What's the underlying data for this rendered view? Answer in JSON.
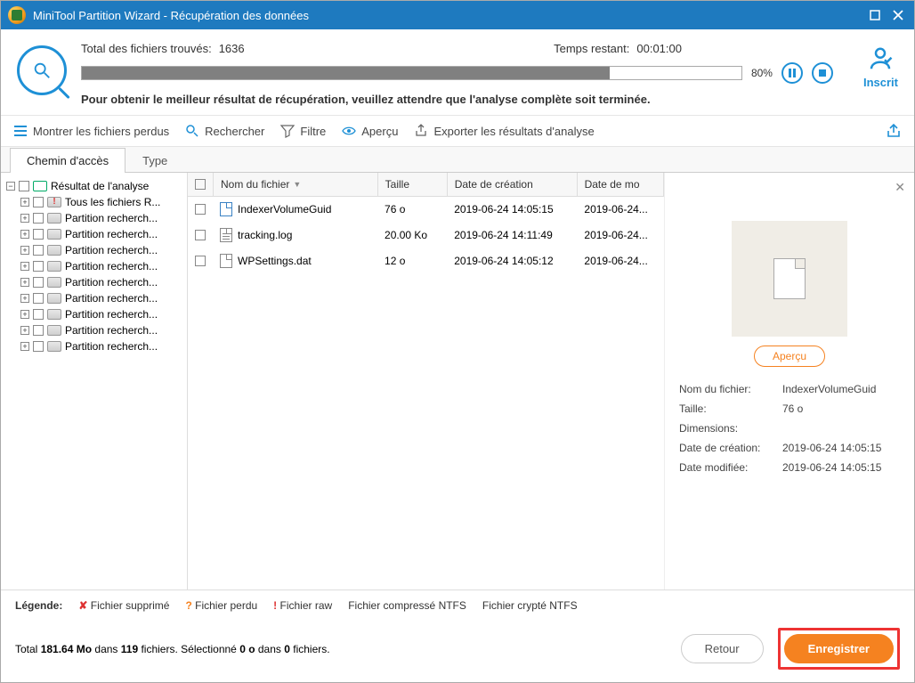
{
  "title": "MiniTool Partition Wizard - Récupération des données",
  "header": {
    "found_label": "Total des fichiers trouvés:",
    "found_value": "1636",
    "remain_label": "Temps restant:",
    "remain_value": "00:01:00",
    "progress_percent": "80%",
    "tip": "Pour obtenir le meilleur résultat de récupération, veuillez attendre que l'analyse complète soit terminée.",
    "inscrit": "Inscrit"
  },
  "toolbar": {
    "show_lost": "Montrer les fichiers perdus",
    "search": "Rechercher",
    "filter": "Filtre",
    "preview": "Aperçu",
    "export": "Exporter les résultats d'analyse"
  },
  "tabs": {
    "path": "Chemin d'accès",
    "type": "Type"
  },
  "tree": {
    "root": "Résultat de l'analyse",
    "items": [
      "Tous les fichiers R...",
      "Partition recherch...",
      "Partition recherch...",
      "Partition recherch...",
      "Partition recherch...",
      "Partition recherch...",
      "Partition recherch...",
      "Partition recherch...",
      "Partition recherch...",
      "Partition recherch..."
    ]
  },
  "columns": {
    "name": "Nom du fichier",
    "size": "Taille",
    "created": "Date de création",
    "modified": "Date de mo"
  },
  "files": [
    {
      "name": "IndexerVolumeGuid",
      "size": "76 o",
      "created": "2019-06-24 14:05:15",
      "modified": "2019-06-24...",
      "icon": "blue"
    },
    {
      "name": "tracking.log",
      "size": "20.00 Ko",
      "created": "2019-06-24 14:11:49",
      "modified": "2019-06-24...",
      "icon": "lines"
    },
    {
      "name": "WPSettings.dat",
      "size": "12 o",
      "created": "2019-06-24 14:05:12",
      "modified": "2019-06-24...",
      "icon": "plain"
    }
  ],
  "detail": {
    "preview_btn": "Aperçu",
    "k_name": "Nom du fichier:",
    "v_name": "IndexerVolumeGuid",
    "k_size": "Taille:",
    "v_size": "76 o",
    "k_dim": "Dimensions:",
    "v_dim": "",
    "k_created": "Date de création:",
    "v_created": "2019-06-24 14:05:15",
    "k_modified": "Date modifiée:",
    "v_modified": "2019-06-24 14:05:15"
  },
  "legend": {
    "label": "Légende:",
    "deleted": "Fichier supprimé",
    "lost": "Fichier perdu",
    "raw": "Fichier raw",
    "ntfs_c": "Fichier compressé NTFS",
    "ntfs_e": "Fichier crypté NTFS"
  },
  "status": {
    "prefix": "Total ",
    "total_size": "181.64 Mo",
    "mid1": " dans ",
    "total_files": "119",
    "mid2": " fichiers.  Sélectionné ",
    "sel_size": "0 o",
    "mid3": " dans ",
    "sel_files": "0",
    "suffix": " fichiers."
  },
  "buttons": {
    "back": "Retour",
    "save": "Enregistrer"
  }
}
